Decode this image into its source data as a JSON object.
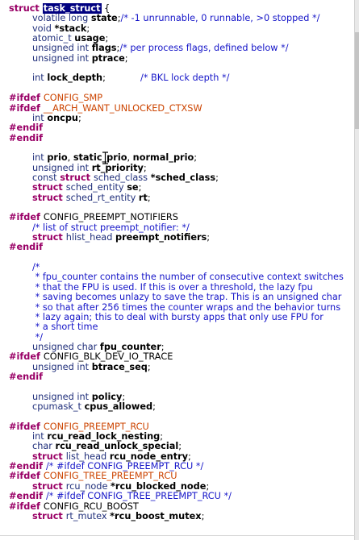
{
  "colors": {
    "keyword": "#990066",
    "type": "#1f2e7a",
    "comment": "#1515c8",
    "condition": "#cc4400",
    "selection": "#000080"
  },
  "code_lines": [
    {
      "indent": 0,
      "tokens": [
        {
          "t": "struct ",
          "c": "kw"
        },
        {
          "t": "task_struct",
          "c": "sel"
        },
        {
          "t": " {",
          "c": "pl"
        }
      ]
    },
    {
      "indent": 1,
      "tokens": [
        {
          "t": "volatile long ",
          "c": "ty"
        },
        {
          "t": "state",
          "c": "id"
        },
        {
          "t": ";",
          "c": "pl"
        },
        {
          "t": "/* -1 unrunnable, 0 runnable, >0 stopped */",
          "c": "cm"
        }
      ]
    },
    {
      "indent": 1,
      "tokens": [
        {
          "t": "void ",
          "c": "ty"
        },
        {
          "t": "*stack",
          "c": "id"
        },
        {
          "t": ";",
          "c": "pl"
        }
      ]
    },
    {
      "indent": 1,
      "tokens": [
        {
          "t": "atomic_t ",
          "c": "ty"
        },
        {
          "t": "usage",
          "c": "id"
        },
        {
          "t": ";",
          "c": "pl"
        }
      ]
    },
    {
      "indent": 1,
      "tokens": [
        {
          "t": "unsigned int ",
          "c": "ty"
        },
        {
          "t": "flags",
          "c": "id"
        },
        {
          "t": ";",
          "c": "pl"
        },
        {
          "t": "/* per process flags, defined below */",
          "c": "cm"
        }
      ]
    },
    {
      "indent": 1,
      "tokens": [
        {
          "t": "unsigned int ",
          "c": "ty"
        },
        {
          "t": "ptrace",
          "c": "id"
        },
        {
          "t": ";",
          "c": "pl"
        }
      ]
    },
    {
      "indent": 0,
      "tokens": []
    },
    {
      "indent": 1,
      "tokens": [
        {
          "t": "int ",
          "c": "ty"
        },
        {
          "t": "lock_depth",
          "c": "id"
        },
        {
          "t": ";            ",
          "c": "pl"
        },
        {
          "t": "/* BKL lock depth */",
          "c": "cm"
        }
      ]
    },
    {
      "indent": 0,
      "tokens": []
    },
    {
      "indent": 0,
      "tokens": [
        {
          "t": "#ifdef ",
          "c": "pp"
        },
        {
          "t": "CONFIG_SMP",
          "c": "ct"
        }
      ]
    },
    {
      "indent": 0,
      "tokens": [
        {
          "t": "#ifdef ",
          "c": "pp"
        },
        {
          "t": "__ARCH_WANT_UNLOCKED_CTXSW",
          "c": "ct"
        }
      ]
    },
    {
      "indent": 1,
      "tokens": [
        {
          "t": "int ",
          "c": "ty"
        },
        {
          "t": "oncpu",
          "c": "id"
        },
        {
          "t": ";",
          "c": "pl"
        }
      ]
    },
    {
      "indent": 0,
      "tokens": [
        {
          "t": "#endif",
          "c": "pp"
        }
      ]
    },
    {
      "indent": 0,
      "tokens": [
        {
          "t": "#endif",
          "c": "pp"
        }
      ]
    },
    {
      "indent": 0,
      "tokens": []
    },
    {
      "indent": 1,
      "tokens": [
        {
          "t": "int ",
          "c": "ty"
        },
        {
          "t": "prio",
          "c": "id"
        },
        {
          "t": ", ",
          "c": "pl"
        },
        {
          "t": "static_prio",
          "c": "id"
        },
        {
          "t": ", ",
          "c": "pl"
        },
        {
          "t": "normal_prio",
          "c": "id"
        },
        {
          "t": ";",
          "c": "pl"
        }
      ]
    },
    {
      "indent": 1,
      "tokens": [
        {
          "t": "unsigned int ",
          "c": "ty"
        },
        {
          "t": "rt_priority",
          "c": "id"
        },
        {
          "t": ";",
          "c": "pl"
        }
      ]
    },
    {
      "indent": 1,
      "tokens": [
        {
          "t": "const ",
          "c": "ty"
        },
        {
          "t": "struct ",
          "c": "kw"
        },
        {
          "t": "sched_class ",
          "c": "ty"
        },
        {
          "t": "*sched_class",
          "c": "id"
        },
        {
          "t": ";",
          "c": "pl"
        }
      ]
    },
    {
      "indent": 1,
      "tokens": [
        {
          "t": "struct ",
          "c": "kw"
        },
        {
          "t": "sched_entity ",
          "c": "ty"
        },
        {
          "t": "se",
          "c": "id"
        },
        {
          "t": ";",
          "c": "pl"
        }
      ]
    },
    {
      "indent": 1,
      "tokens": [
        {
          "t": "struct ",
          "c": "kw"
        },
        {
          "t": "sched_rt_entity ",
          "c": "ty"
        },
        {
          "t": "rt",
          "c": "id"
        },
        {
          "t": ";",
          "c": "pl"
        }
      ]
    },
    {
      "indent": 0,
      "tokens": []
    },
    {
      "indent": 0,
      "tokens": [
        {
          "t": "#ifdef ",
          "c": "pp"
        },
        {
          "t": "CONFIG_PREEMPT_NOTIFIERS",
          "c": "pl"
        }
      ]
    },
    {
      "indent": 1,
      "tokens": [
        {
          "t": "/* list of struct preempt_notifier: */",
          "c": "cm"
        }
      ]
    },
    {
      "indent": 1,
      "tokens": [
        {
          "t": "struct ",
          "c": "kw"
        },
        {
          "t": "hlist_head ",
          "c": "ty"
        },
        {
          "t": "preempt_notifiers",
          "c": "id"
        },
        {
          "t": ";",
          "c": "pl"
        }
      ]
    },
    {
      "indent": 0,
      "tokens": [
        {
          "t": "#endif",
          "c": "pp"
        }
      ]
    },
    {
      "indent": 0,
      "tokens": []
    },
    {
      "indent": 1,
      "tokens": [
        {
          "t": "/*",
          "c": "cm"
        }
      ]
    },
    {
      "indent": 1,
      "tokens": [
        {
          "t": " * fpu_counter contains the number of consecutive context switches",
          "c": "cm"
        }
      ]
    },
    {
      "indent": 1,
      "tokens": [
        {
          "t": " * that the FPU is used. If this is over a threshold, the lazy fpu",
          "c": "cm"
        }
      ]
    },
    {
      "indent": 1,
      "tokens": [
        {
          "t": " * saving becomes unlazy to save the trap. This is an unsigned char",
          "c": "cm"
        }
      ]
    },
    {
      "indent": 1,
      "tokens": [
        {
          "t": " * so that after 256 times the counter wraps and the behavior turns",
          "c": "cm"
        }
      ]
    },
    {
      "indent": 1,
      "tokens": [
        {
          "t": " * lazy again; this to deal with bursty apps that only use FPU for",
          "c": "cm"
        }
      ]
    },
    {
      "indent": 1,
      "tokens": [
        {
          "t": " * a short time",
          "c": "cm"
        }
      ]
    },
    {
      "indent": 1,
      "tokens": [
        {
          "t": " */",
          "c": "cm"
        }
      ]
    },
    {
      "indent": 1,
      "tokens": [
        {
          "t": "unsigned char ",
          "c": "ty"
        },
        {
          "t": "fpu_counter",
          "c": "id"
        },
        {
          "t": ";",
          "c": "pl"
        }
      ]
    },
    {
      "indent": 0,
      "tokens": [
        {
          "t": "#ifdef ",
          "c": "pp"
        },
        {
          "t": "CONFIG_BLK_DEV_IO_TRACE",
          "c": "pl"
        }
      ]
    },
    {
      "indent": 1,
      "tokens": [
        {
          "t": "unsigned int ",
          "c": "ty"
        },
        {
          "t": "btrace_seq",
          "c": "id"
        },
        {
          "t": ";",
          "c": "pl"
        }
      ]
    },
    {
      "indent": 0,
      "tokens": [
        {
          "t": "#endif",
          "c": "pp"
        }
      ]
    },
    {
      "indent": 0,
      "tokens": []
    },
    {
      "indent": 1,
      "tokens": [
        {
          "t": "unsigned int ",
          "c": "ty"
        },
        {
          "t": "policy",
          "c": "id"
        },
        {
          "t": ";",
          "c": "pl"
        }
      ]
    },
    {
      "indent": 1,
      "tokens": [
        {
          "t": "cpumask_t ",
          "c": "ty"
        },
        {
          "t": "cpus_allowed",
          "c": "id"
        },
        {
          "t": ";",
          "c": "pl"
        }
      ]
    },
    {
      "indent": 0,
      "tokens": []
    },
    {
      "indent": 0,
      "tokens": [
        {
          "t": "#ifdef ",
          "c": "pp"
        },
        {
          "t": "CONFIG_PREEMPT_RCU",
          "c": "ct"
        }
      ]
    },
    {
      "indent": 1,
      "tokens": [
        {
          "t": "int ",
          "c": "ty"
        },
        {
          "t": "rcu_read_lock_nesting",
          "c": "id"
        },
        {
          "t": ";",
          "c": "pl"
        }
      ]
    },
    {
      "indent": 1,
      "tokens": [
        {
          "t": "char ",
          "c": "ty"
        },
        {
          "t": "rcu_read_unlock_special",
          "c": "id"
        },
        {
          "t": ";",
          "c": "pl"
        }
      ]
    },
    {
      "indent": 1,
      "tokens": [
        {
          "t": "struct ",
          "c": "kw"
        },
        {
          "t": "list_head ",
          "c": "ty"
        },
        {
          "t": "rcu_node_entry",
          "c": "id"
        },
        {
          "t": ";",
          "c": "pl"
        }
      ]
    },
    {
      "indent": 0,
      "tokens": [
        {
          "t": "#endif ",
          "c": "pp"
        },
        {
          "t": "/* #ifdef CONFIG_PREEMPT_RCU */",
          "c": "cm"
        }
      ]
    },
    {
      "indent": 0,
      "tokens": [
        {
          "t": "#ifdef ",
          "c": "pp"
        },
        {
          "t": "CONFIG_TREE_PREEMPT_RCU",
          "c": "ct"
        }
      ]
    },
    {
      "indent": 1,
      "tokens": [
        {
          "t": "struct ",
          "c": "kw"
        },
        {
          "t": "rcu_node ",
          "c": "ty"
        },
        {
          "t": "*rcu_blocked_node",
          "c": "id"
        },
        {
          "t": ";",
          "c": "pl"
        }
      ]
    },
    {
      "indent": 0,
      "tokens": [
        {
          "t": "#endif ",
          "c": "pp"
        },
        {
          "t": "/* #ifdef CONFIG_TREE_PREEMPT_RCU */",
          "c": "cm"
        }
      ]
    },
    {
      "indent": 0,
      "tokens": [
        {
          "t": "#ifdef ",
          "c": "pp"
        },
        {
          "t": "CONFIG_RCU_BOOST",
          "c": "pl"
        }
      ]
    },
    {
      "indent": 1,
      "tokens": [
        {
          "t": "struct ",
          "c": "kw"
        },
        {
          "t": "rt_mutex ",
          "c": "ty"
        },
        {
          "t": "*rcu_boost_mutex",
          "c": "id"
        },
        {
          "t": ";",
          "c": "pl"
        }
      ]
    }
  ]
}
